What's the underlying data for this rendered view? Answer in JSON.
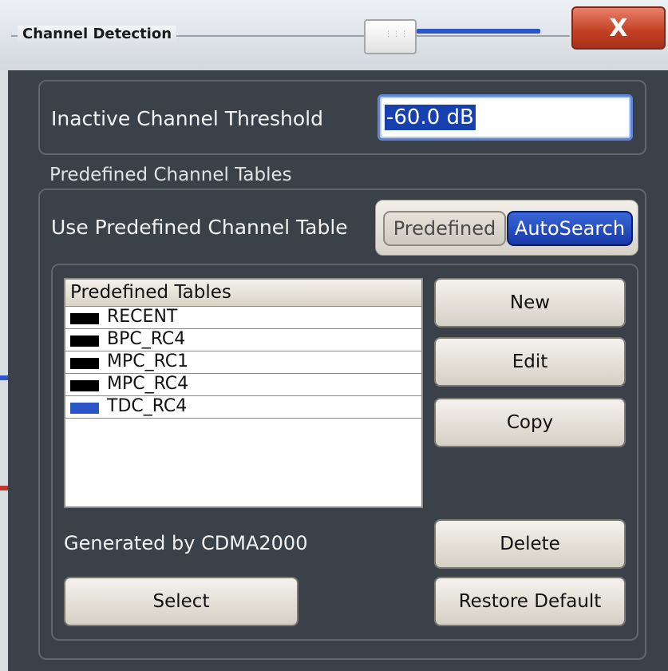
{
  "dialog": {
    "title": "Channel Detection",
    "close_label": "X",
    "close_color": "#c23f22"
  },
  "threshold": {
    "label": "Inactive Channel Threshold",
    "value": "-60.0 dB"
  },
  "predefined_section": {
    "caption": "Predefined Channel Tables",
    "use_label": "Use Predefined Channel Table",
    "toggle": {
      "options": [
        "Predefined",
        "AutoSearch"
      ],
      "selected": "AutoSearch",
      "selected_color": "#1e46b8"
    }
  },
  "table": {
    "header": "Predefined Tables",
    "rows": [
      {
        "label": "RECENT",
        "swatch": "#000000"
      },
      {
        "label": "BPC_RC4",
        "swatch": "#000000"
      },
      {
        "label": "MPC_RC1",
        "swatch": "#000000"
      },
      {
        "label": "MPC_RC4",
        "swatch": "#000000"
      },
      {
        "label": "TDC_RC4",
        "swatch": "#2b55c8"
      }
    ]
  },
  "buttons": {
    "new": "New",
    "edit": "Edit",
    "copy": "Copy",
    "delete": "Delete",
    "restore_default": "Restore Default",
    "select": "Select"
  },
  "generated_by": "Generated by CDMA2000"
}
